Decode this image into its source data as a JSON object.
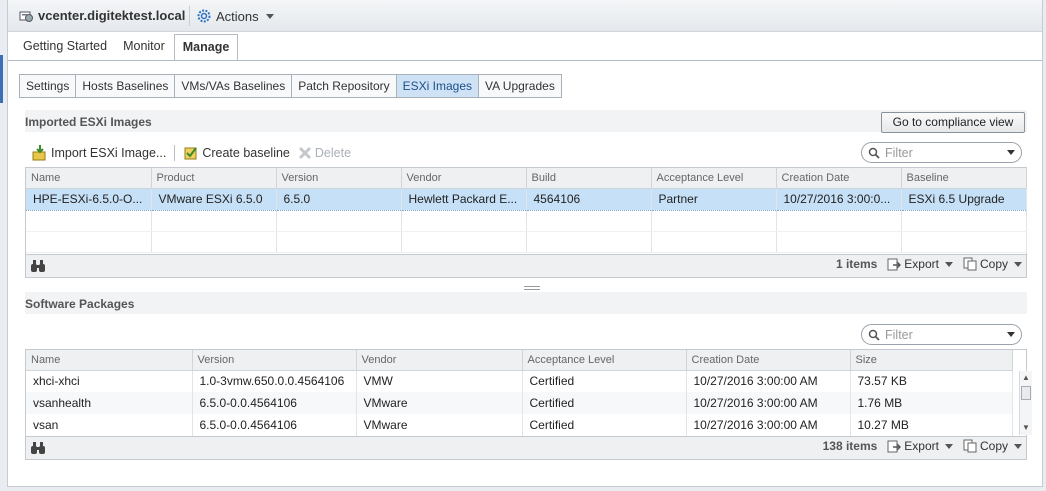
{
  "window": {
    "title": "vcenter.digitektest.local",
    "actions_label": "Actions"
  },
  "main_tabs": [
    {
      "label": "Getting Started"
    },
    {
      "label": "Monitor"
    },
    {
      "label": "Manage"
    }
  ],
  "sub_tabs": [
    {
      "label": "Settings"
    },
    {
      "label": "Hosts Baselines"
    },
    {
      "label": "VMs/VAs Baselines"
    },
    {
      "label": "Patch Repository"
    },
    {
      "label": "ESXi Images"
    },
    {
      "label": "VA Upgrades"
    }
  ],
  "imported": {
    "title": "Imported ESXi Images",
    "compliance_button": "Go to compliance view",
    "toolbar": {
      "import": "Import ESXi Image...",
      "create_baseline": "Create baseline",
      "delete": "Delete"
    },
    "filter_placeholder": "Filter",
    "columns": [
      "Name",
      "Product",
      "Version",
      "Vendor",
      "Build",
      "Acceptance Level",
      "Creation Date",
      "Baseline"
    ],
    "rows": [
      [
        "HPE-ESXi-6.5.0-O...",
        "VMware ESXi 6.5.0",
        "6.5.0",
        "Hewlett Packard E...",
        "4564106",
        "Partner",
        "10/27/2016 3:00:0...",
        "ESXi 6.5 Upgrade"
      ]
    ],
    "count": "1 items",
    "export": "Export",
    "copy": "Copy"
  },
  "packages": {
    "title": "Software Packages",
    "filter_placeholder": "Filter",
    "columns": [
      "Name",
      "Version",
      "Vendor",
      "Acceptance Level",
      "Creation Date",
      "Size"
    ],
    "rows": [
      [
        "xhci-xhci",
        "1.0-3vmw.650.0.0.4564106",
        "VMW",
        "Certified",
        "10/27/2016 3:00:00 AM",
        "73.57  KB"
      ],
      [
        "vsanhealth",
        "6.5.0-0.0.4564106",
        "VMware",
        "Certified",
        "10/27/2016 3:00:00 AM",
        "1.76  MB"
      ],
      [
        "vsan",
        "6.5.0-0.0.4564106",
        "VMware",
        "Certified",
        "10/27/2016 3:00:00 AM",
        "10.27  MB"
      ]
    ],
    "count": "138 items",
    "export": "Export",
    "copy": "Copy"
  },
  "colors": {
    "selected_tab": "#cfe2f5",
    "selected_row": "#c5e0f7"
  }
}
